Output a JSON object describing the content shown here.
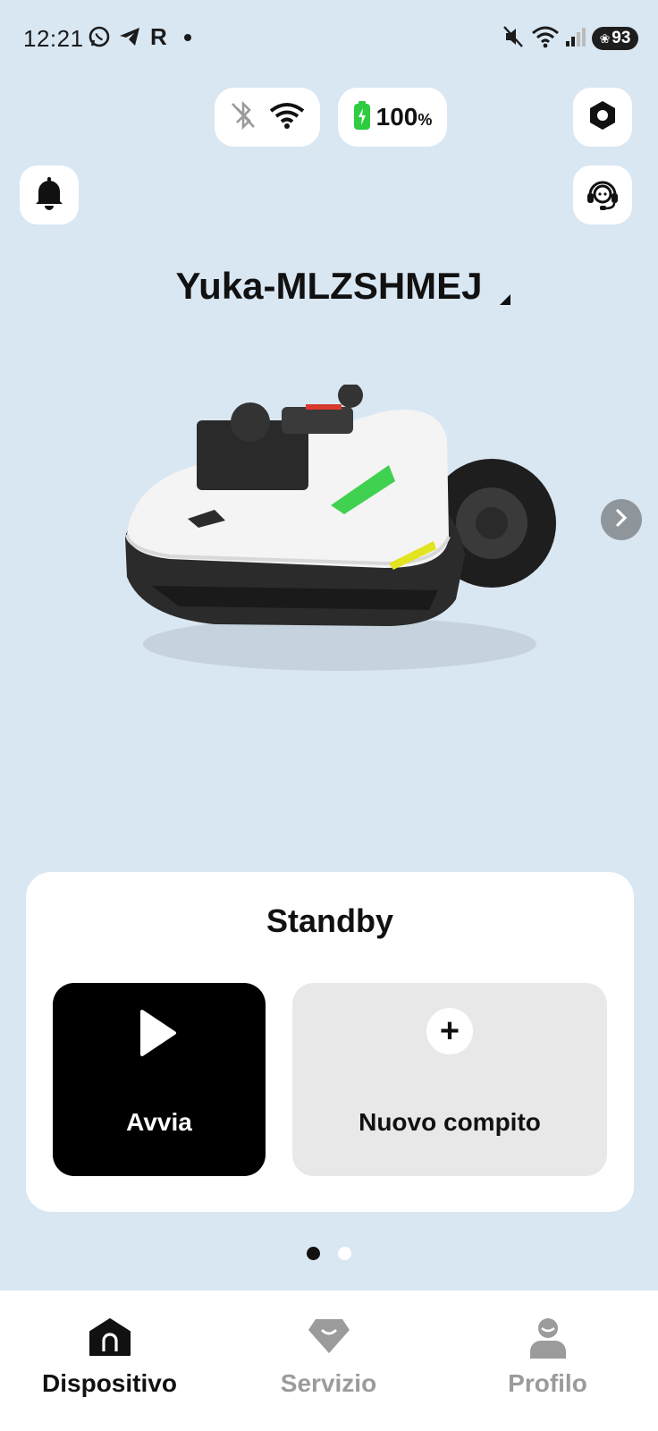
{
  "status_bar": {
    "time": "12:21",
    "carrier_letter": "R",
    "battery_level": "93"
  },
  "top": {
    "battery_percent": "100",
    "battery_unit": "%"
  },
  "device": {
    "name": "Yuka-MLZSHMEJ"
  },
  "card": {
    "status": "Standby",
    "start_label": "Avvia",
    "new_task_label": "Nuovo compito"
  },
  "pager": {
    "current_page": 1,
    "total_pages": 2
  },
  "nav": {
    "items": [
      {
        "label": "Dispositivo",
        "active": true
      },
      {
        "label": "Servizio",
        "active": false
      },
      {
        "label": "Profilo",
        "active": false
      }
    ]
  },
  "colors": {
    "background": "#d9e7f3",
    "accent_green": "#2ecc40",
    "active_nav": "#111111",
    "inactive_nav": "#9b9b9b"
  }
}
